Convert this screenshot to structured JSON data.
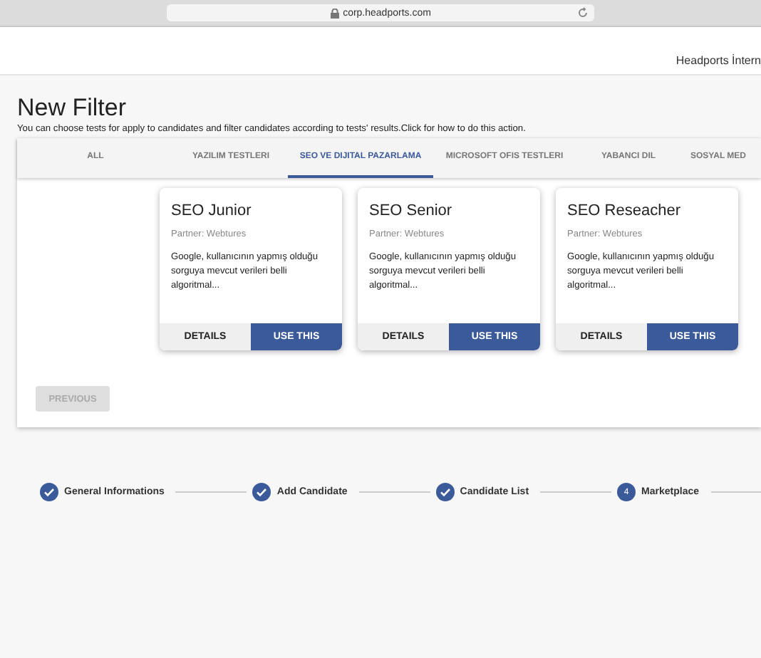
{
  "browser": {
    "url": "corp.headports.com"
  },
  "header": {
    "company": "Headports İntern"
  },
  "title": "New Filter",
  "description": "You can choose tests for apply to candidates and filter candidates according to tests' results.Click for how to do this action.",
  "tabs": [
    {
      "label": "ALL",
      "selected": false
    },
    {
      "label": "YAZILIM TESTLERI",
      "selected": false
    },
    {
      "label": "SEO VE DIJITAL PAZARLAMA",
      "selected": true
    },
    {
      "label": "MICROSOFT OFIS TESTLERI",
      "selected": false
    },
    {
      "label": "YABANCI DIL",
      "selected": false
    },
    {
      "label": "SOSYAL MED",
      "selected": false
    }
  ],
  "cards": [
    {
      "title": "SEO Junior",
      "partner": "Partner: Webtures",
      "text": "Google, kullanıcının yapmış olduğu sorguya mevcut verileri belli algoritmal...",
      "details": "DETAILS",
      "use": "USE THIS"
    },
    {
      "title": "SEO Senior",
      "partner": "Partner: Webtures",
      "text": "Google, kullanıcının yapmış olduğu sorguya mevcut verileri belli algoritmal...",
      "details": "DETAILS",
      "use": "USE THIS"
    },
    {
      "title": "SEO Reseacher",
      "partner": "Partner: Webtures",
      "text": "Google, kullanıcının yapmış olduğu sorguya mevcut verileri belli algoritmal...",
      "details": "DETAILS",
      "use": "USE THIS"
    }
  ],
  "previous": {
    "label": "PREVIOUS",
    "disabled": true
  },
  "steps": [
    {
      "label": "General Informations",
      "completed": true
    },
    {
      "label": "Add Candidate",
      "completed": true
    },
    {
      "label": "Candidate List",
      "completed": true
    },
    {
      "label": "Marketplace",
      "completed": false,
      "number": "4"
    }
  ]
}
